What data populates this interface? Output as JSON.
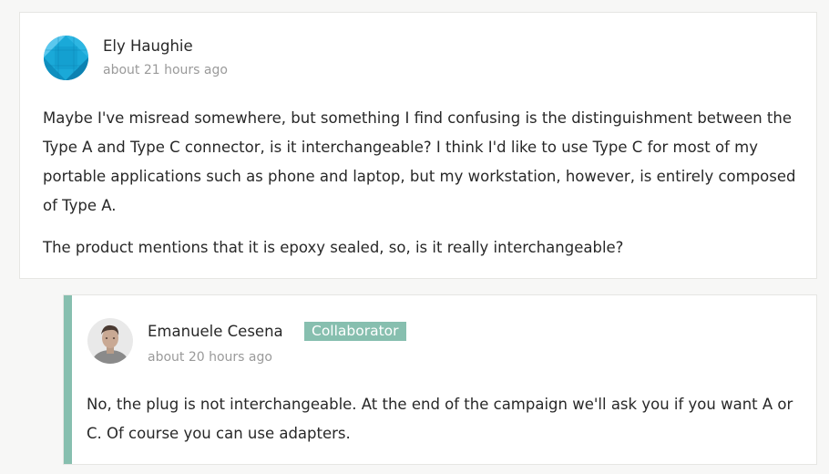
{
  "comments": [
    {
      "author": "Ely Haughie",
      "timestamp": "about 21 hours ago",
      "avatar_icon": "geometric-blue-avatar",
      "paragraphs": [
        "Maybe I've misread somewhere, but something I find confusing is the distinguishment between the Type A and Type C connector, is it interchangeable? I think I'd like to use Type C for most of my portable applications such as phone and laptop, but my workstation, however, is entirely composed of Type A.",
        "The product mentions that it is epoxy sealed, so, is it really interchangeable?"
      ]
    }
  ],
  "reply": {
    "author": "Emanuele Cesena",
    "badge": "Collaborator",
    "timestamp": "about 20 hours ago",
    "avatar_icon": "user-photo-avatar",
    "paragraphs": [
      "No, the plug is not interchangeable. At the end of the campaign we'll ask you if you want A or C. Of course you can use adapters."
    ]
  },
  "colors": {
    "accent": "#87bfaf",
    "text": "#282828",
    "muted": "#9a9a9a",
    "page_bg": "#f7f7f6"
  }
}
